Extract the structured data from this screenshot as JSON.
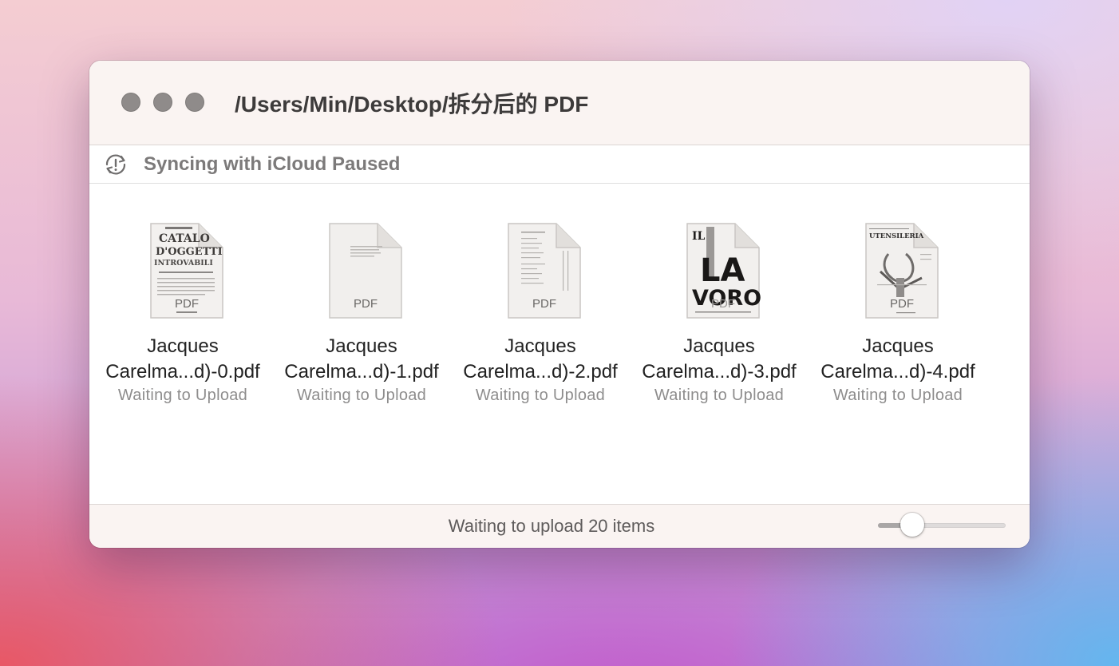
{
  "window": {
    "title": "/Users/Min/Desktop/拆分后的 PDF",
    "traffic_lights": [
      "close-button",
      "minimize-button",
      "zoom-button"
    ]
  },
  "status": {
    "icon": "sync-paused-icon",
    "text": "Syncing with iCloud Paused"
  },
  "files": [
    {
      "name_line1": "Jacques",
      "name_line2": "Carelma...d)-0.pdf",
      "status": "Waiting to Upload",
      "thumb_label": "PDF",
      "thumb_style": "catalog",
      "thumb_text": [
        "CATALO",
        "D'OGGETTI",
        "INTROVABILI"
      ]
    },
    {
      "name_line1": "Jacques",
      "name_line2": "Carelma...d)-1.pdf",
      "status": "Waiting to Upload",
      "thumb_label": "PDF",
      "thumb_style": "blank",
      "thumb_text": []
    },
    {
      "name_line1": "Jacques",
      "name_line2": "Carelma...d)-2.pdf",
      "status": "Waiting to Upload",
      "thumb_label": "PDF",
      "thumb_style": "index",
      "thumb_text": []
    },
    {
      "name_line1": "Jacques",
      "name_line2": "Carelma...d)-3.pdf",
      "status": "Waiting to Upload",
      "thumb_label": "PDF",
      "thumb_style": "poster",
      "thumb_text": [
        "IL",
        "LA",
        "VORO"
      ]
    },
    {
      "name_line1": "Jacques",
      "name_line2": "Carelma...d)-4.pdf",
      "status": "Waiting to Upload",
      "thumb_label": "PDF",
      "thumb_style": "tools",
      "thumb_text": [
        "UTENSILERIA"
      ]
    }
  ],
  "footer": {
    "text": "Waiting to upload 20 items",
    "zoom_slider_value": 0.27
  },
  "colors": {
    "titlebar_bg": "#faf4f2",
    "traffic_light": "#8f8b8a",
    "status_text": "#7c7a7a",
    "file_status": "#8e8d8d"
  }
}
